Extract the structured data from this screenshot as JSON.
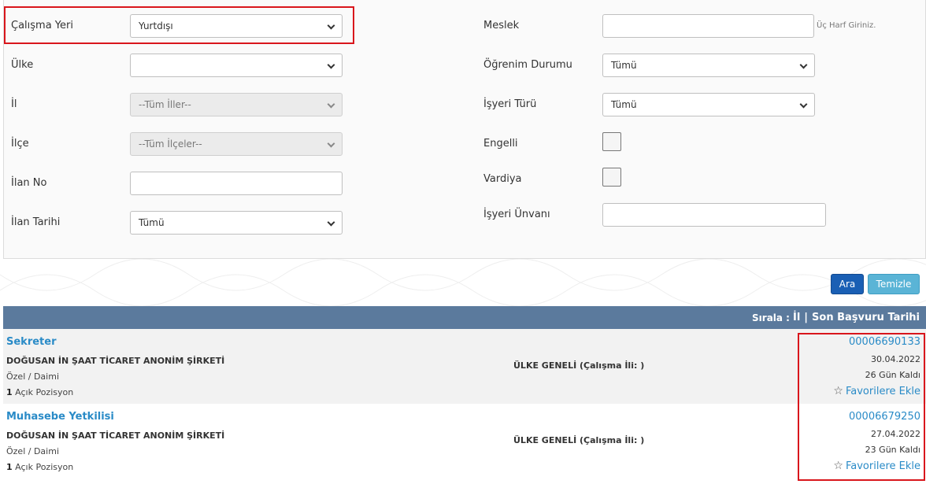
{
  "form": {
    "calisma_yeri": {
      "label": "Çalışma Yeri",
      "value": "Yurtdışı"
    },
    "ulke": {
      "label": "Ülke",
      "value": ""
    },
    "il": {
      "label": "İl",
      "value": "--Tüm İller--"
    },
    "ilce": {
      "label": "İlçe",
      "value": "--Tüm İlçeler--"
    },
    "ilan_no": {
      "label": "İlan No",
      "value": ""
    },
    "ilan_tarihi": {
      "label": "İlan Tarihi",
      "value": "Tümü"
    },
    "meslek": {
      "label": "Meslek",
      "value": "",
      "hint": "Üç Harf Giriniz."
    },
    "ogrenim_durumu": {
      "label": "Öğrenim Durumu",
      "value": "Tümü"
    },
    "isyeri_turu": {
      "label": "İşyeri Türü",
      "value": "Tümü"
    },
    "engelli": {
      "label": "Engelli"
    },
    "vardiya": {
      "label": "Vardiya"
    },
    "isyeri_unvani": {
      "label": "İşyeri Ünvanı",
      "value": ""
    }
  },
  "buttons": {
    "search": "Ara",
    "clear": "Temizle"
  },
  "sort": {
    "label": "Sırala :",
    "option1": "İl",
    "separator": "|",
    "option2": "Son Başvuru Tarihi"
  },
  "results": [
    {
      "title": "Sekreter",
      "company": "DOĞUSAN İN ŞAAT TİCARET ANONİM ŞİRKETİ",
      "type": "Özel / Daimi",
      "positions_count": "1",
      "positions_label": "Açık Pozisyon",
      "location": "ÜLKE GENELİ (Çalışma İli: )",
      "listing_no": "00006690133",
      "date": "30.04.2022",
      "days_left": "26 Gün Kaldı",
      "favorite": "Favorilere Ekle"
    },
    {
      "title": "Muhasebe Yetkilisi",
      "company": "DOĞUSAN İN ŞAAT TİCARET ANONİM ŞİRKETİ",
      "type": "Özel / Daimi",
      "positions_count": "1",
      "positions_label": "Açık Pozisyon",
      "location": "ÜLKE GENELİ (Çalışma İli: )",
      "listing_no": "00006679250",
      "date": "27.04.2022",
      "days_left": "23 Gün Kaldı",
      "favorite": "Favorilere Ekle"
    }
  ],
  "colors": {
    "highlight": "#d9161c",
    "link": "#2a8bc7",
    "sortbar": "#5b7a9d",
    "search_button": "#1a5fb4",
    "clear_button": "#5ab4d6"
  },
  "icons": {
    "favorite": "star-outline-icon",
    "dropdown": "chevron-down-icon"
  }
}
